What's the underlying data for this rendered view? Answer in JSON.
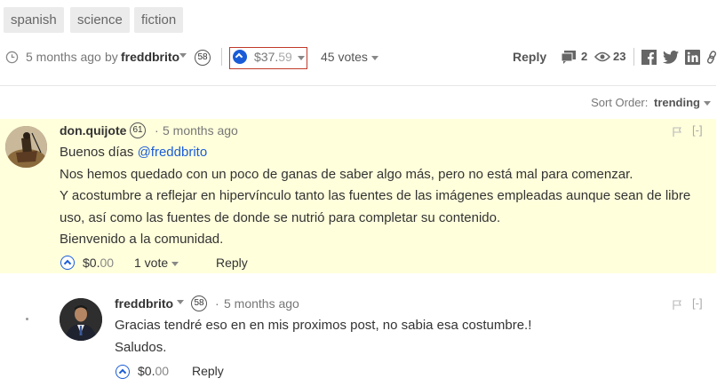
{
  "tags": [
    "spanish",
    "science",
    "fiction"
  ],
  "post_footer": {
    "time_ago": "5 months ago",
    "by_label": "by",
    "author": "freddbrito",
    "author_rep": "58",
    "payout_dollars": "$37.",
    "payout_cents": "59",
    "votes": "45 votes",
    "reply_label": "Reply",
    "comments_count": "2",
    "views_count": "23"
  },
  "sort": {
    "label": "Sort Order:",
    "value": "trending"
  },
  "comments": [
    {
      "author": "don.quijote",
      "rep": "61",
      "separator": "·",
      "time_ago": "5 months ago",
      "greeting": "Buenos días ",
      "mention": "@freddbrito",
      "lines": [
        "Nos hemos quedado con un poco de ganas de saber algo más, pero no está mal para comenzar.",
        "Y acostumbre a reflejar en hipervínculo tanto las fuentes de las imágenes empleadas aunque sean de libre",
        "uso, así como las fuentes de donde se nutrió para completar su contenido.",
        "Bienvenido a la comunidad."
      ],
      "payout_dollars": "$0.",
      "payout_cents": "00",
      "votes": "1 vote",
      "reply_label": "Reply",
      "collapse_label": "[-]"
    },
    {
      "author": "freddbrito",
      "rep": "58",
      "separator": "·",
      "time_ago": "5 months ago",
      "lines": [
        "Gracias tendré eso en en mis proximos post, no sabia esa costumbre.!",
        "Saludos."
      ],
      "payout_dollars": "$0.",
      "payout_cents": "00",
      "reply_label": "Reply",
      "collapse_label": "[-]"
    }
  ],
  "colors": {
    "accent": "#1a5cd7",
    "highlight_bg": "#ffffdc",
    "payout_border": "#c0392b"
  },
  "icons": [
    "clock-icon",
    "upvote-icon",
    "comments-icon",
    "eye-icon",
    "facebook-icon",
    "twitter-icon",
    "linkedin-icon",
    "link-icon",
    "flag-icon"
  ]
}
